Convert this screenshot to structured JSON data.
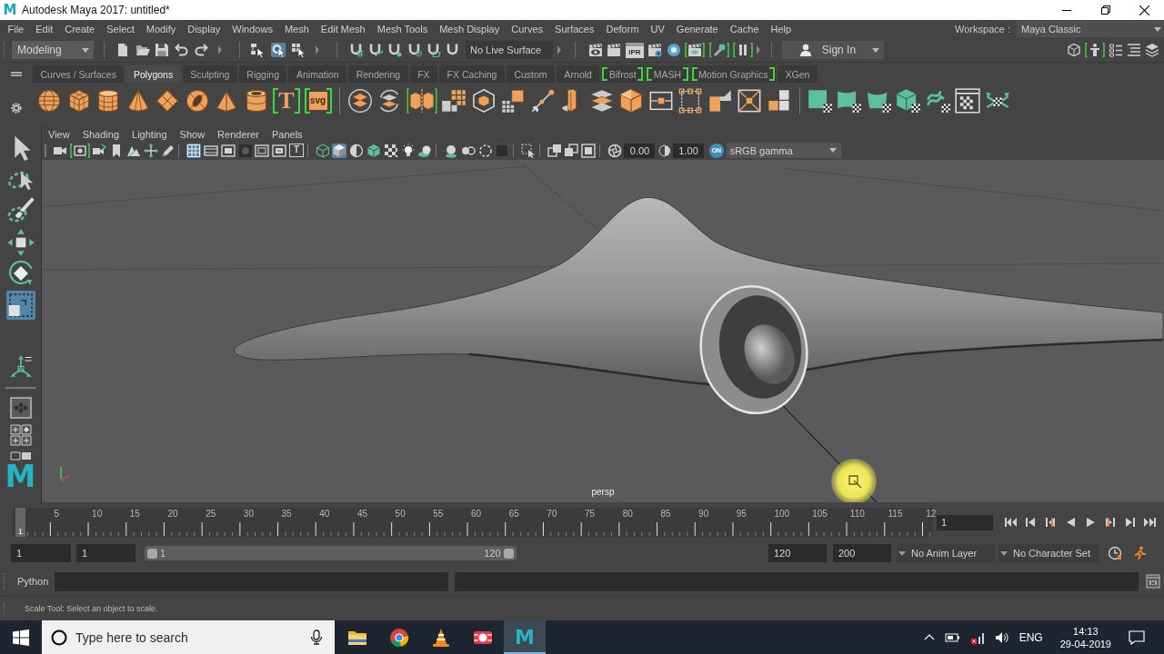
{
  "window": {
    "logo": "M",
    "title": "Autodesk Maya 2017: untitled*"
  },
  "menu_bar": {
    "items": [
      "File",
      "Edit",
      "Create",
      "Select",
      "Modify",
      "Display",
      "Windows",
      "Mesh",
      "Edit Mesh",
      "Mesh Tools",
      "Mesh Display",
      "Curves",
      "Surfaces",
      "Deform",
      "UV",
      "Generate",
      "Cache",
      "Help"
    ],
    "workspace_label": "Workspace :",
    "workspace": "Maya Classic"
  },
  "status_line": {
    "mode": "Modeling",
    "select_modes": [
      {
        "selected": false
      },
      {
        "selected": true
      },
      {
        "selected": false
      }
    ],
    "live_surface": "No Live Surface",
    "render_tools": [
      {
        "highlighted": false
      },
      {
        "highlighted": false
      },
      {
        "label": "IPR",
        "highlighted": false
      },
      {
        "highlighted": false
      },
      {
        "highlighted": false
      },
      {
        "highlighted": true
      },
      {
        "highlighted": true
      },
      {
        "highlighted": true
      }
    ],
    "sign_in": "Sign In",
    "panel_tools": [
      {
        "highlighted": false
      },
      {
        "highlighted": true
      },
      {
        "highlighted": false
      },
      {
        "highlighted": false
      },
      {
        "highlighted": false
      }
    ]
  },
  "shelf": {
    "tabs": [
      {
        "label": "Curves / Surfaces",
        "selected": false,
        "highlighted": false
      },
      {
        "label": "Polygons",
        "selected": true,
        "highlighted": false
      },
      {
        "label": "Sculpting",
        "selected": false,
        "highlighted": false
      },
      {
        "label": "Rigging",
        "selected": false,
        "highlighted": false
      },
      {
        "label": "Animation",
        "selected": false,
        "highlighted": false
      },
      {
        "label": "Rendering",
        "selected": false,
        "highlighted": false
      },
      {
        "label": "FX",
        "selected": false,
        "highlighted": false
      },
      {
        "label": "FX Caching",
        "selected": false,
        "highlighted": false
      },
      {
        "label": "Custom",
        "selected": false,
        "highlighted": false
      },
      {
        "label": "Arnold",
        "selected": false,
        "highlighted": false
      },
      {
        "label": "Bifrost",
        "selected": false,
        "highlighted": true
      },
      {
        "label": "MASH",
        "selected": false,
        "highlighted": true
      },
      {
        "label": "Motion Graphics",
        "selected": false,
        "highlighted": true
      },
      {
        "label": "XGen",
        "selected": false,
        "highlighted": false
      }
    ],
    "tools": [
      [
        {
          "highlighted": false
        },
        {
          "highlighted": false
        },
        {
          "highlighted": false
        },
        {
          "highlighted": false
        },
        {
          "highlighted": false
        },
        {
          "highlighted": false
        },
        {
          "highlighted": false
        },
        {
          "highlighted": false
        },
        {
          "label": "T",
          "highlighted": true
        },
        {
          "label": "svg",
          "highlighted": true
        }
      ],
      [
        {
          "highlighted": false
        },
        {
          "highlighted": false
        },
        {
          "highlighted": true
        },
        {
          "highlighted": false
        },
        {
          "highlighted": false
        },
        {
          "highlighted": false
        },
        {
          "highlighted": false
        },
        {
          "highlighted": false
        },
        {
          "highlighted": false
        },
        {
          "highlighted": false
        },
        {
          "highlighted": false
        },
        {
          "highlighted": false
        },
        {
          "highlighted": false
        },
        {
          "highlighted": false
        },
        {
          "highlighted": false
        }
      ],
      [
        {
          "highlighted": false
        },
        {
          "highlighted": false
        },
        {
          "highlighted": false
        },
        {
          "highlighted": false
        },
        {
          "highlighted": false
        },
        {
          "highlighted": false
        },
        {
          "highlighted": false
        }
      ]
    ]
  },
  "toolbox": {
    "tools": [
      {
        "selected": false
      },
      {
        "selected": false
      },
      {
        "selected": false
      },
      {
        "selected": false
      },
      {
        "selected": false
      },
      {
        "selected": true
      }
    ],
    "logo": "M"
  },
  "viewport": {
    "menus": [
      "View",
      "Shading",
      "Lighting",
      "Show",
      "Renderer",
      "Panels"
    ],
    "toolbar": {
      "groups": [
        [
          {
            "selected": false,
            "highlighted": false
          },
          {
            "selected": false,
            "highlighted": true
          },
          {
            "selected": false,
            "highlighted": false
          },
          {
            "selected": false,
            "highlighted": false
          },
          {
            "selected": false,
            "highlighted": false
          },
          {
            "selected": false,
            "highlighted": false
          },
          {
            "selected": false,
            "highlighted": false
          }
        ],
        [
          {
            "selected": true,
            "highlighted": false
          },
          {
            "selected": false,
            "highlighted": false
          },
          {
            "selected": false,
            "highlighted": false
          },
          {
            "selected": false,
            "highlighted": false
          },
          {
            "selected": false,
            "highlighted": false
          },
          {
            "selected": false,
            "highlighted": false
          },
          {
            "label": "T",
            "selected": false,
            "highlighted": false
          }
        ],
        [
          {
            "selected": false,
            "highlighted": false
          },
          {
            "selected": true,
            "highlighted": false
          },
          {
            "selected": false,
            "highlighted": false
          },
          {
            "selected": false,
            "highlighted": false
          },
          {
            "selected": false,
            "highlighted": false
          },
          {
            "selected": false,
            "highlighted": false
          },
          {
            "selected": false,
            "highlighted": false
          }
        ],
        [
          {
            "selected": false,
            "highlighted": false
          },
          {
            "selected": false,
            "highlighted": false
          },
          {
            "selected": false,
            "highlighted": false
          },
          {
            "selected": false,
            "highlighted": false
          }
        ],
        [
          {
            "selected": false,
            "highlighted": false
          }
        ],
        [
          {
            "selected": false,
            "highlighted": false
          },
          {
            "selected": false,
            "highlighted": false
          },
          {
            "selected": false,
            "highlighted": false
          }
        ]
      ],
      "exposure": "0.00",
      "gamma": "1.00",
      "color_management": {
        "label": "ON",
        "on": true
      },
      "view_transform": "sRGB gamma"
    },
    "camera": "persp"
  },
  "time_slider": {
    "labels": [
      "5",
      "10",
      "15",
      "20",
      "25",
      "30",
      "35",
      "40",
      "45",
      "50",
      "55",
      "60",
      "65",
      "70",
      "75",
      "80",
      "85",
      "90",
      "95",
      "100",
      "105",
      "110",
      "115",
      "12"
    ],
    "current_marker": "1",
    "level": 0,
    "current_frame": "1"
  },
  "range_slider": {
    "start": "1",
    "playback_start": "1",
    "range_start": "1",
    "range_end": "120",
    "level": 0.6,
    "playback_end": "120",
    "end": "200",
    "anim_layer": "No Anim Layer",
    "character_set": "No Character Set"
  },
  "command_line": {
    "language": "Python"
  },
  "help_line": "Scale Tool: Select an object to scale.",
  "taskbar": {
    "search_placeholder": "Type here to search",
    "apps": [
      {
        "selected": false
      },
      {
        "selected": false
      },
      {
        "selected": false
      },
      {
        "selected": false
      },
      {
        "label": "M",
        "selected": true
      }
    ],
    "language": "ENG",
    "time": "14:13",
    "date": "29-04-2019"
  }
}
